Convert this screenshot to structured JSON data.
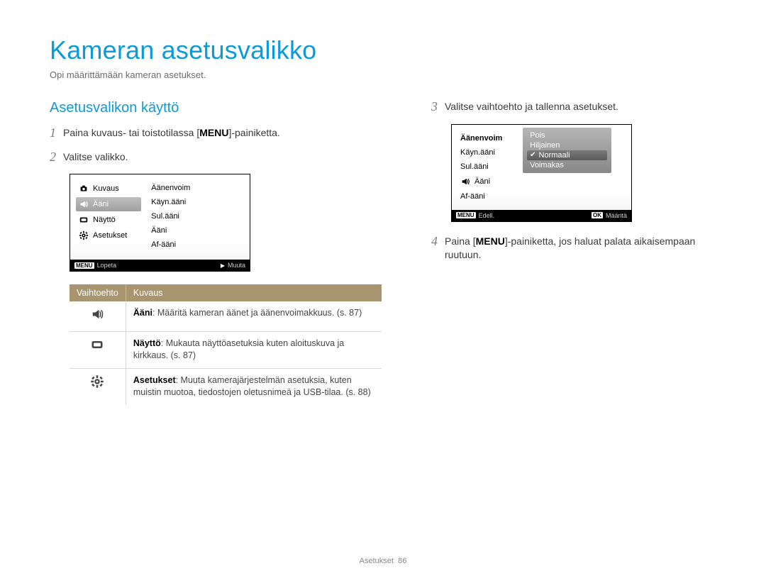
{
  "page": {
    "title": "Kameran asetusvalikko",
    "subtitle": "Opi määrittämään kameran asetukset."
  },
  "section": {
    "heading": "Asetusvalikon käyttö"
  },
  "steps": {
    "s1_num": "1",
    "s1_pre": "Paina kuvaus- tai toistotilassa [",
    "s1_menu": "MENU",
    "s1_post": "]-painiketta.",
    "s2_num": "2",
    "s2_text": "Valitse valikko.",
    "s3_num": "3",
    "s3_text": "Valitse vaihtoehto ja tallenna asetukset.",
    "s4_num": "4",
    "s4_pre": "Paina [",
    "s4_menu": "MENU",
    "s4_post": "]-painiketta, jos haluat palata aikaisempaan ruutuun."
  },
  "screen1": {
    "left": {
      "kuvaus": "Kuvaus",
      "aani": "Ääni",
      "naytto": "Näyttö",
      "asetukset": "Asetukset"
    },
    "right": {
      "aanenvoim": "Äänenvoim",
      "kayn": "Käyn.ääni",
      "sul": "Sul.ääni",
      "aani": "Ääni",
      "af": "Af-ääni"
    },
    "foot": {
      "menu_chip": "MENU",
      "lopeta": "Lopeta",
      "muuta": "Muuta"
    }
  },
  "screen2": {
    "left": {
      "aanenvoim": "Äänenvoim",
      "kayn": "Käyn.ääni",
      "sul": "Sul.ääni",
      "aani": "Ääni",
      "af": "Af-ääni"
    },
    "popup": {
      "pois": "Pois",
      "hiljainen": "Hiljainen",
      "normaali": "Normaali",
      "voimakas": "Voimakas"
    },
    "foot": {
      "menu_chip": "MENU",
      "edell": "Edell.",
      "ok_chip": "OK",
      "maarita": "Määritä"
    }
  },
  "table": {
    "th1": "Vaihtoehto",
    "th2": "Kuvaus",
    "r1_bold": "Ääni",
    "r1_rest": ": Määritä kameran äänet ja äänenvoimakkuus. (s. 87)",
    "r2_bold": "Näyttö",
    "r2_rest": ": Mukauta näyttöasetuksia kuten aloituskuva ja kirkkaus. (s. 87)",
    "r3_bold": "Asetukset",
    "r3_rest": ": Muuta kamerajärjestelmän asetuksia, kuten muistin muotoa, tiedostojen oletusnimeä ja USB-tilaa. (s. 88)"
  },
  "footer": {
    "section": "Asetukset",
    "page": "86"
  }
}
